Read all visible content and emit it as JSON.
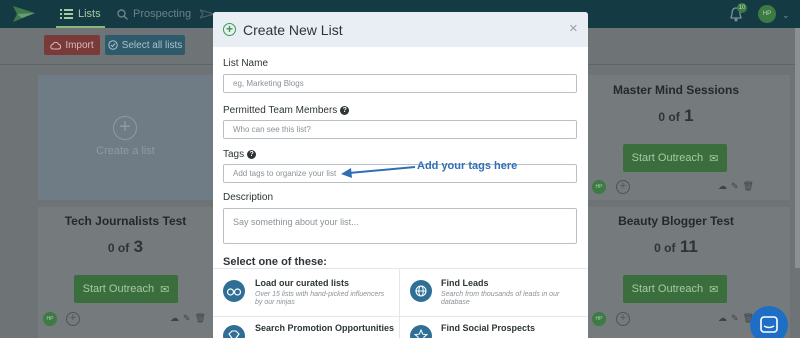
{
  "nav": {
    "lists": "Lists",
    "prospecting": "Prospecting",
    "notification_count": "10",
    "user_initials": "HP"
  },
  "toolbar": {
    "import": "Import",
    "select_all": "Select all lists"
  },
  "cards": {
    "create_label": "Create a list",
    "items": [
      {
        "title": "Master Mind Sessions",
        "of_label": "0 of",
        "total": "1",
        "button": "Start Outreach",
        "avatar": "HP"
      },
      {
        "title": "Tech Journalists Test",
        "of_label": "0 of",
        "total": "3",
        "button": "Start Outreach",
        "avatar": "HP"
      },
      {
        "title": "Beauty Blogger Test",
        "of_label": "0 of",
        "total": "11",
        "button": "Start Outreach",
        "avatar": "HP"
      }
    ]
  },
  "modal": {
    "title": "Create New List",
    "close": "×",
    "list_name_label": "List Name",
    "list_name_placeholder": "eg, Marketing Blogs",
    "team_label": "Permitted Team Members",
    "team_placeholder": "Who can see this list?",
    "tags_label": "Tags",
    "tags_placeholder": "Add tags to organize your list",
    "tags_annotation": "Add your tags here",
    "description_label": "Description",
    "description_placeholder": "Say something about your list...",
    "select_heading": "Select one of these:",
    "options": [
      {
        "title": "Load our curated lists",
        "desc": "Over 15 lists with hand-picked influencers by our ninjas",
        "icon": "glasses-icon"
      },
      {
        "title": "Find Leads",
        "desc": "Search from thousands of leads in our database",
        "icon": "globe-icon"
      },
      {
        "title": "Search Promotion Opportunities",
        "desc": "",
        "icon": "diamond-icon"
      },
      {
        "title": "Find Social Prospects",
        "desc": "",
        "icon": "star-icon"
      }
    ]
  }
}
